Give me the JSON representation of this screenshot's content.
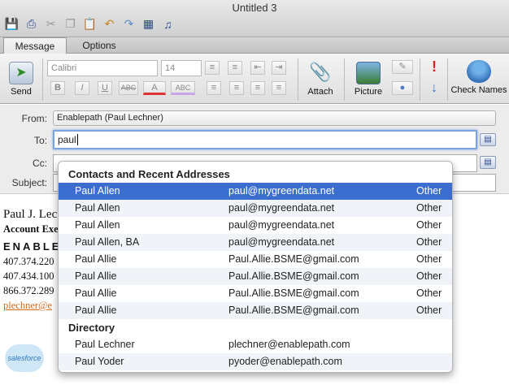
{
  "window": {
    "title": "Untitled 3"
  },
  "tabs": [
    {
      "label": "Message"
    },
    {
      "label": "Options"
    }
  ],
  "ribbon": {
    "send": "Send",
    "font": "Calibri",
    "size": "14",
    "attach": "Attach",
    "picture": "Picture",
    "check_names": "Check Names",
    "bold": "B",
    "italic": "I",
    "underline": "U",
    "strike": "ABC",
    "color": "A",
    "highlight": "ABC"
  },
  "header": {
    "from_label": "From:",
    "from_value": "Enablepath (Paul Lechner)",
    "to_label": "To:",
    "to_value": "paul",
    "cc_label": "Cc:",
    "subject_label": "Subject:"
  },
  "body": {
    "line1": "Paul J. Lec",
    "line2": "Account Exe",
    "line3": "ENABLE",
    "line4": "407.374.220",
    "line5": "407.434.100",
    "line6": "866.372.289",
    "line7": "plechner@e",
    "logo": "salesforce"
  },
  "popup": {
    "contacts_header": "Contacts and Recent Addresses",
    "contacts": [
      {
        "name": "Paul Allen",
        "email": "paul@mygreendata.net",
        "type": "Other"
      },
      {
        "name": "Paul Allen",
        "email": "paul@mygreendata.net",
        "type": "Other"
      },
      {
        "name": "Paul Allen",
        "email": "paul@mygreendata.net",
        "type": "Other"
      },
      {
        "name": "Paul Allen, BA",
        "email": "paul@mygreendata.net",
        "type": "Other"
      },
      {
        "name": "Paul Allie",
        "email": "Paul.Allie.BSME@gmail.com",
        "type": "Other"
      },
      {
        "name": "Paul Allie",
        "email": "Paul.Allie.BSME@gmail.com",
        "type": "Other"
      },
      {
        "name": "Paul Allie",
        "email": "Paul.Allie.BSME@gmail.com",
        "type": "Other"
      },
      {
        "name": "Paul Allie",
        "email": "Paul.Allie.BSME@gmail.com",
        "type": "Other"
      }
    ],
    "directory_header": "Directory",
    "directory": [
      {
        "name": "Paul Lechner",
        "email": "plechner@enablepath.com"
      },
      {
        "name": "Paul Yoder",
        "email": "pyoder@enablepath.com"
      }
    ]
  }
}
